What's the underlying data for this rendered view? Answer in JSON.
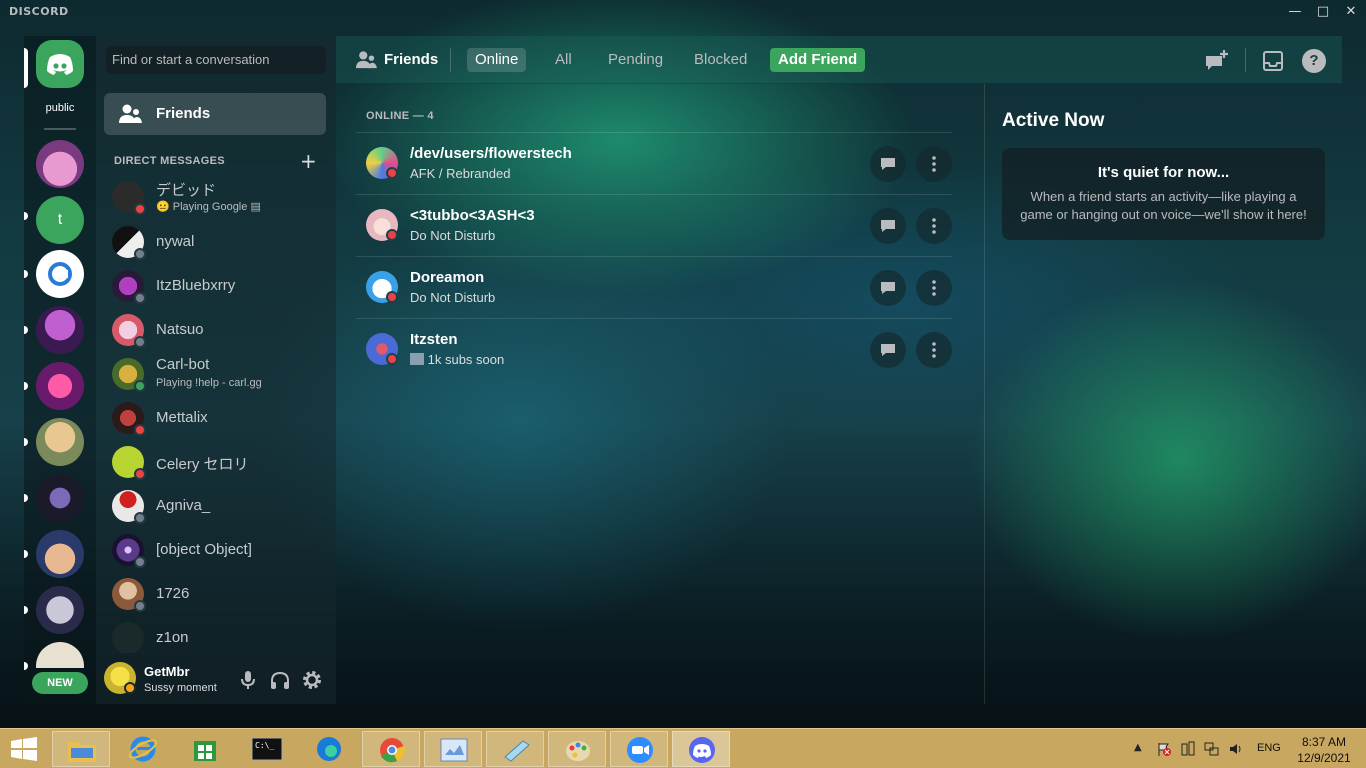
{
  "window": {
    "brand": "DISCORD"
  },
  "rail": {
    "home_label": "public",
    "new_badge": "NEW",
    "server_t": "t"
  },
  "dms": {
    "search_placeholder": "Find or start a conversation",
    "friends_label": "Friends",
    "header": "DIRECT MESSAGES",
    "items": [
      {
        "name": "デビッド",
        "sub": "Playing Google",
        "status": "dnd",
        "color": "#2b2b2b"
      },
      {
        "name": "nywal",
        "sub": "",
        "status": "offline",
        "color": "#eeeeee"
      },
      {
        "name": "ItzBluebxrry",
        "sub": "",
        "status": "offline",
        "color": "#3a2a4a"
      },
      {
        "name": "Natsuo",
        "sub": "",
        "status": "offline",
        "color": "#d85a6a"
      },
      {
        "name": "Carl-bot",
        "sub": "Playing !help - carl.gg",
        "status": "online",
        "color": "#6a8a3a"
      },
      {
        "name": "Mettalix",
        "sub": "",
        "status": "dnd",
        "color": "#4a2a2a"
      },
      {
        "name": "Celery セロリ",
        "sub": "",
        "status": "dnd",
        "color": "#b8d430"
      },
      {
        "name": "Agniva_",
        "sub": "",
        "status": "offline",
        "color": "#d0d0d0"
      },
      {
        "name": "[object Object]",
        "sub": "",
        "status": "offline",
        "color": "#5a3a8a"
      },
      {
        "name": "1726",
        "sub": "",
        "status": "offline",
        "color": "#b08a6a"
      },
      {
        "name": "z1on",
        "sub": "",
        "status": "offline",
        "color": "#1a2a2a"
      }
    ]
  },
  "user": {
    "name": "GetMbr",
    "status_text": "Sussy moment"
  },
  "header": {
    "title": "Friends",
    "tabs": {
      "online": "Online",
      "all": "All",
      "pending": "Pending",
      "blocked": "Blocked",
      "add": "Add Friend"
    }
  },
  "friends": {
    "section": "ONLINE — 4",
    "items": [
      {
        "name": "/dev/users/flowerstech",
        "sub": "AFK / Rebranded",
        "color": "#5fd08a"
      },
      {
        "name": "<3tubbo<3ASH<3",
        "sub": "Do Not Disturb",
        "color": "#e8b8c0"
      },
      {
        "name": "Doreamon",
        "sub": "Do Not Disturb",
        "color": "#3aa0e8"
      },
      {
        "name": "Itzsten",
        "sub": "1k subs soon",
        "color": "#4a6ad8"
      }
    ]
  },
  "active_now": {
    "title": "Active Now",
    "quiet_title": "It's quiet for now...",
    "quiet_desc": "When a friend starts an activity—like playing a game or hanging out on voice—we'll show it here!"
  },
  "taskbar": {
    "lang": "ENG",
    "time": "8:37 AM",
    "date": "12/9/2021"
  },
  "colors": {
    "accent": "#5865f2",
    "green": "#3ba55d",
    "dnd": "#ed4245",
    "offline": "#747f8d",
    "online": "#3ba55d"
  }
}
